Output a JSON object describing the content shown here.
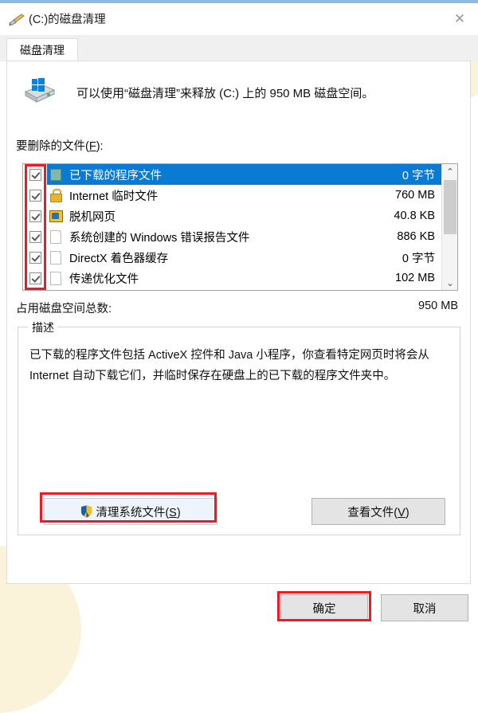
{
  "window": {
    "title": "(C:)的磁盘清理",
    "title_icon": "broom-icon",
    "close_label": "✕"
  },
  "tabs": [
    {
      "label": "磁盘清理",
      "active": true
    }
  ],
  "header": {
    "drive_icon": "disk-drive-icon",
    "message": "可以使用“磁盘清理”来释放 (C:) 上的 950 MB 磁盘空间。"
  },
  "list_section": {
    "label_prefix": "要删除的文件(",
    "label_accel": "F",
    "label_suffix": "):",
    "items": [
      {
        "name": "已下载的程序文件",
        "size": "0 字节",
        "checked": true,
        "selected": true,
        "icon": "program-file-icon"
      },
      {
        "name": "Internet 临时文件",
        "size": "760 MB",
        "checked": true,
        "selected": false,
        "icon": "lock-icon"
      },
      {
        "name": "脱机网页",
        "size": "40.8 KB",
        "checked": true,
        "selected": false,
        "icon": "offline-pages-icon"
      },
      {
        "name": "系统创建的 Windows 错误报告文件",
        "size": "886 KB",
        "checked": true,
        "selected": false,
        "icon": "page-icon"
      },
      {
        "name": "DirectX 着色器缓存",
        "size": "0 字节",
        "checked": true,
        "selected": false,
        "icon": "page-icon"
      },
      {
        "name": "传递优化文件",
        "size": "102 MB",
        "checked": true,
        "selected": false,
        "icon": "page-icon"
      }
    ],
    "scrollbar": {
      "up_arrow": "⌃",
      "down_arrow": "⌄"
    }
  },
  "total": {
    "label": "占用磁盘空间总数:",
    "value": "950 MB"
  },
  "description": {
    "legend": "描述",
    "text": "已下载的程序文件包括 ActiveX 控件和 Java 小程序，你查看特定网页时将会从 Internet 自动下载它们，并临时保存在硬盘上的已下载的程序文件夹中。",
    "clean_system_files": {
      "prefix": "清理系统文件(",
      "accel": "S",
      "suffix": ")",
      "icon": "uac-shield-icon"
    },
    "view_files": {
      "prefix": "查看文件(",
      "accel": "V",
      "suffix": ")"
    }
  },
  "footer": {
    "ok": "确定",
    "cancel": "取消"
  },
  "annotations": {
    "checkbox_column": "red-highlight-checkbox-column",
    "clean_system_files": "red-highlight-clean-system-files",
    "ok": "red-highlight-ok-button"
  },
  "colors": {
    "selection_blue": "#0a7bd4",
    "annotation_red": "#ed1c24",
    "title_accent": "#8cb8e8",
    "backdrop_cream": "#faf3da"
  }
}
